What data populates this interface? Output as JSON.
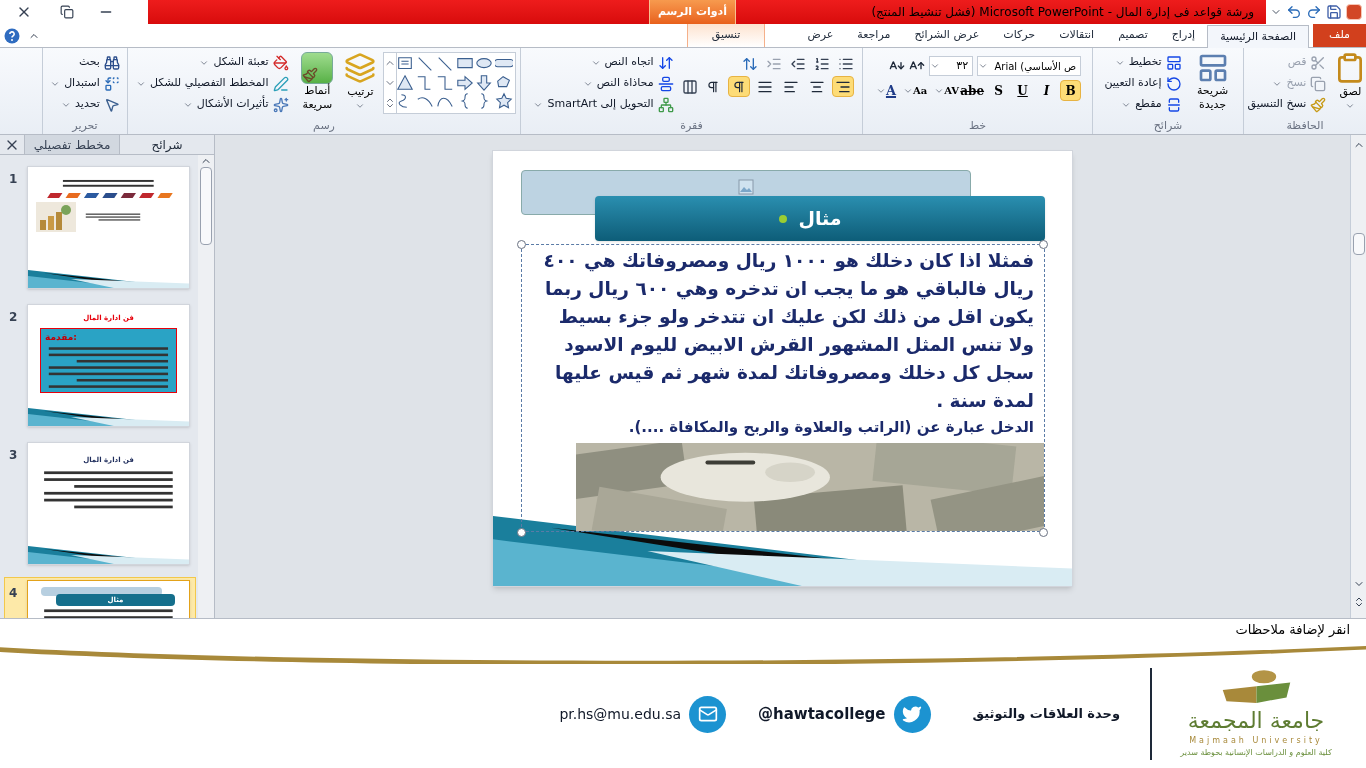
{
  "title_bar": {
    "title": "ورشة قواعد فى إدارة المال  -  Microsoft PowerPoint (فشل تنشيط المنتج)",
    "context_tab": "أدوات الرسم"
  },
  "tabs": [
    {
      "label": "ملف",
      "kind": "file",
      "selected": false
    },
    {
      "label": "الصفحة الرئيسية",
      "kind": "main",
      "selected": true
    },
    {
      "label": "إدراج",
      "kind": "main",
      "selected": false
    },
    {
      "label": "تصميم",
      "kind": "main",
      "selected": false
    },
    {
      "label": "انتقالات",
      "kind": "main",
      "selected": false
    },
    {
      "label": "حركات",
      "kind": "main",
      "selected": false
    },
    {
      "label": "عرض الشرائح",
      "kind": "main",
      "selected": false
    },
    {
      "label": "مراجعة",
      "kind": "main",
      "selected": false
    },
    {
      "label": "عرض",
      "kind": "main",
      "selected": false
    },
    {
      "label": "تنسيق",
      "kind": "context",
      "selected": false
    }
  ],
  "clipboard": {
    "label": "الحافظة",
    "paste": "لصق",
    "cut": {
      "label": "قص",
      "disabled": true
    },
    "copy": {
      "label": "نسخ",
      "disabled": true
    },
    "format_painter": {
      "label": "نسخ التنسيق",
      "disabled": false
    }
  },
  "slides_group": {
    "label": "شرائح",
    "new_slide": "شريحة جديدة",
    "layout": "تخطيط",
    "reset": "إعادة التعيين",
    "section": "مقطع"
  },
  "font": {
    "label": "خط",
    "font_name": "ص الأساسي) Arial",
    "font_size": "٣٢",
    "toggles": [
      {
        "label": "B",
        "selected": true
      },
      {
        "label": "I",
        "selected": false
      },
      {
        "label": "U",
        "selected": false
      },
      {
        "label": "S",
        "selected": false
      },
      {
        "label": "abe",
        "selected": false
      }
    ],
    "menus": [
      "AV",
      "Aa",
      "A"
    ]
  },
  "paragraph": {
    "label": "فقرة",
    "align_buttons": [
      {
        "selected": true
      },
      {
        "selected": false
      },
      {
        "selected": false
      },
      {
        "selected": false
      }
    ],
    "direction_buttons": [
      {
        "selected": true
      },
      {
        "selected": false
      }
    ],
    "text_direction": "اتجاه النص",
    "align_text": "محاذاة النص",
    "smartart": "التحويل إلى SmartArt"
  },
  "drawing": {
    "label": "رسم",
    "arrange": "ترتيب",
    "quick_styles": "أنماط سريعة",
    "shape_fill": "تعبئة الشكل",
    "shape_outline": "المخطط التفصيلي للشكل",
    "shape_effects": "تأثيرات الأشكال"
  },
  "editing": {
    "label": "تحرير",
    "find": "بحث",
    "replace": "استبدال",
    "select": "تحديد"
  },
  "slides_pane": {
    "tabs": [
      {
        "label": "شرائح",
        "selected": true
      },
      {
        "label": "مخطط تفصيلي",
        "selected": false
      }
    ],
    "slides": [
      {
        "number": "1",
        "kind": "title",
        "selected": false
      },
      {
        "number": "2",
        "kind": "box",
        "selected": false,
        "title": "فن ادارة المال",
        "heading": "مقدمة:"
      },
      {
        "number": "3",
        "kind": "bullets",
        "selected": false,
        "title": "فن ادارة المال"
      },
      {
        "number": "4",
        "kind": "example",
        "selected": true,
        "title": "مثال"
      }
    ]
  },
  "slide": {
    "title": "مثال",
    "paragraphs": [
      "فمثلا اذا كان دخلك هو ١٠٠٠ ريال ومصروفاتك هي ٤٠٠ ريال فالباقي هو ما يجب ان تدخره وهي ٦٠٠ ريال ربما يكون اقل من ذلك لكن عليك ان تتدخر ولو جزء بسيط ولا تنس المثل المشهور القرش الابيض لليوم الاسود سجل كل دخلك ومصروفاتك لمدة شهر ثم قيس عليها لمدة سنة .",
      "الدخل عبارة عن (الراتب والعلاوة والربح والمكافاة ....)."
    ]
  },
  "notes": {
    "placeholder": "انقر لإضافة ملاحظات"
  },
  "footer": {
    "university": "جامعة المجمعة",
    "university_en": "Majmaah University",
    "college": "كلية العلوم و الدراسات الإنسانية بحوطة سدير",
    "unit": "وحدة العلاقات والتوثيق",
    "twitter": "@hawtacollege",
    "email": "pr.hs@mu.edu.sa"
  }
}
